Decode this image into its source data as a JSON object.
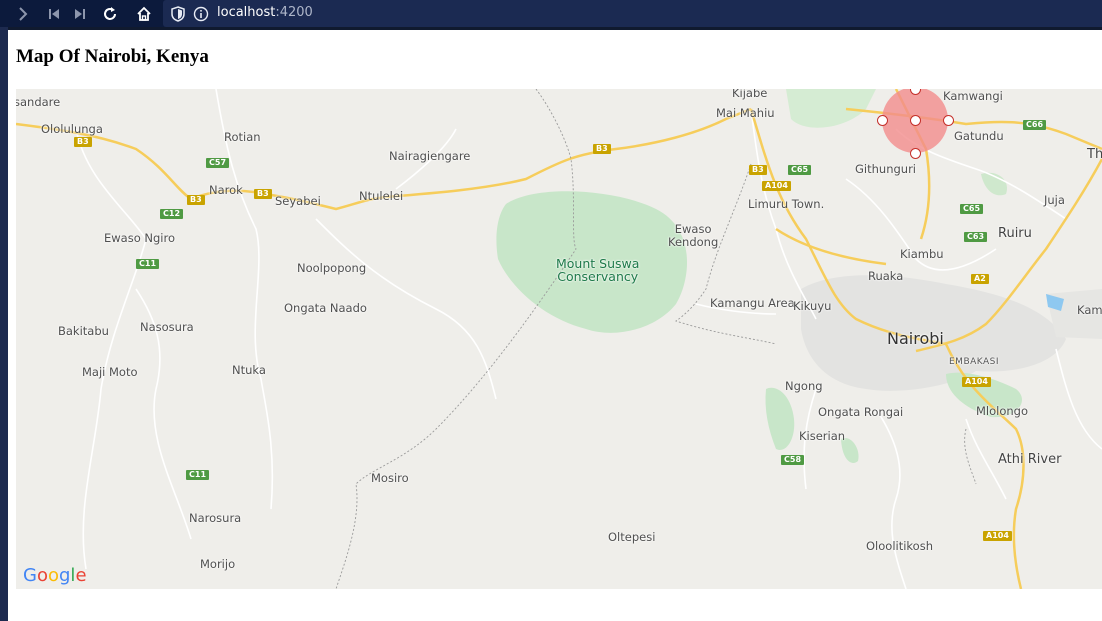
{
  "browser": {
    "url_host": "localhost",
    "url_port": ":4200"
  },
  "page": {
    "title": "Map Of Nairobi, Kenya"
  },
  "map": {
    "google_logo": "Google",
    "places": {
      "isandare": "sandare",
      "ololulunga": "Ololulunga",
      "rotian": "Rotian",
      "nairagiengare": "Nairagiengare",
      "narok": "Narok",
      "seyabei": "Seyabei",
      "ntulelei": "Ntulelei",
      "ewaso_ngiro": "Ewaso Ngiro",
      "noolpopong": "Noolpopong",
      "ongata_naado": "Ongata Naado",
      "bakitabu": "Bakitabu",
      "nasosura": "Nasosura",
      "maji_moto": "Maji Moto",
      "ntuka": "Ntuka",
      "mosiro": "Mosiro",
      "narosura": "Narosura",
      "morijo": "Morijo",
      "oltepesi": "Oltepesi",
      "kijabe": "Kijabe",
      "mai_mahiu": "Mai Mahiu",
      "mount_suswa_1": "Mount Suswa",
      "mount_suswa_2": "Conservancy",
      "ewaso_kendong_1": "Ewaso",
      "ewaso_kendong_2": "Kendong",
      "githunguri": "Githunguri",
      "limuru": "Limuru Town.",
      "kamwangi": "Kamwangi",
      "gatundu": "Gatundu",
      "juja": "Juja",
      "ruiru": "Ruiru",
      "kiambu": "Kiambu",
      "ruaka": "Ruaka",
      "kamangu_area": "Kamangu Area",
      "kikuyu": "Kikuyu",
      "nairobi": "Nairobi",
      "embakasi": "EMBAKASI",
      "ngong": "Ngong",
      "ongata_rongai": "Ongata Rongai",
      "kiserian": "Kiserian",
      "mlolongo": "Mlolongo",
      "athi_river": "Athi River",
      "oloolitikosh": "Oloolitikosh",
      "th": "Th",
      "kam": "Kam"
    },
    "shields": {
      "b3_1": "B3",
      "b3_2": "B3",
      "b3_3": "B3",
      "b3_4": "B3",
      "b3_5": "B3",
      "c57": "C57",
      "c12": "C12",
      "c11_1": "C11",
      "c11_2": "C11",
      "c65_1": "C65",
      "c65_2": "C65",
      "a104_1": "A104",
      "a104_2": "A104",
      "a104_3": "A104",
      "c66": "C66",
      "c63": "C63",
      "a2": "A2",
      "c58": "C58"
    },
    "circle_overlay_color": "#f28c8c"
  }
}
